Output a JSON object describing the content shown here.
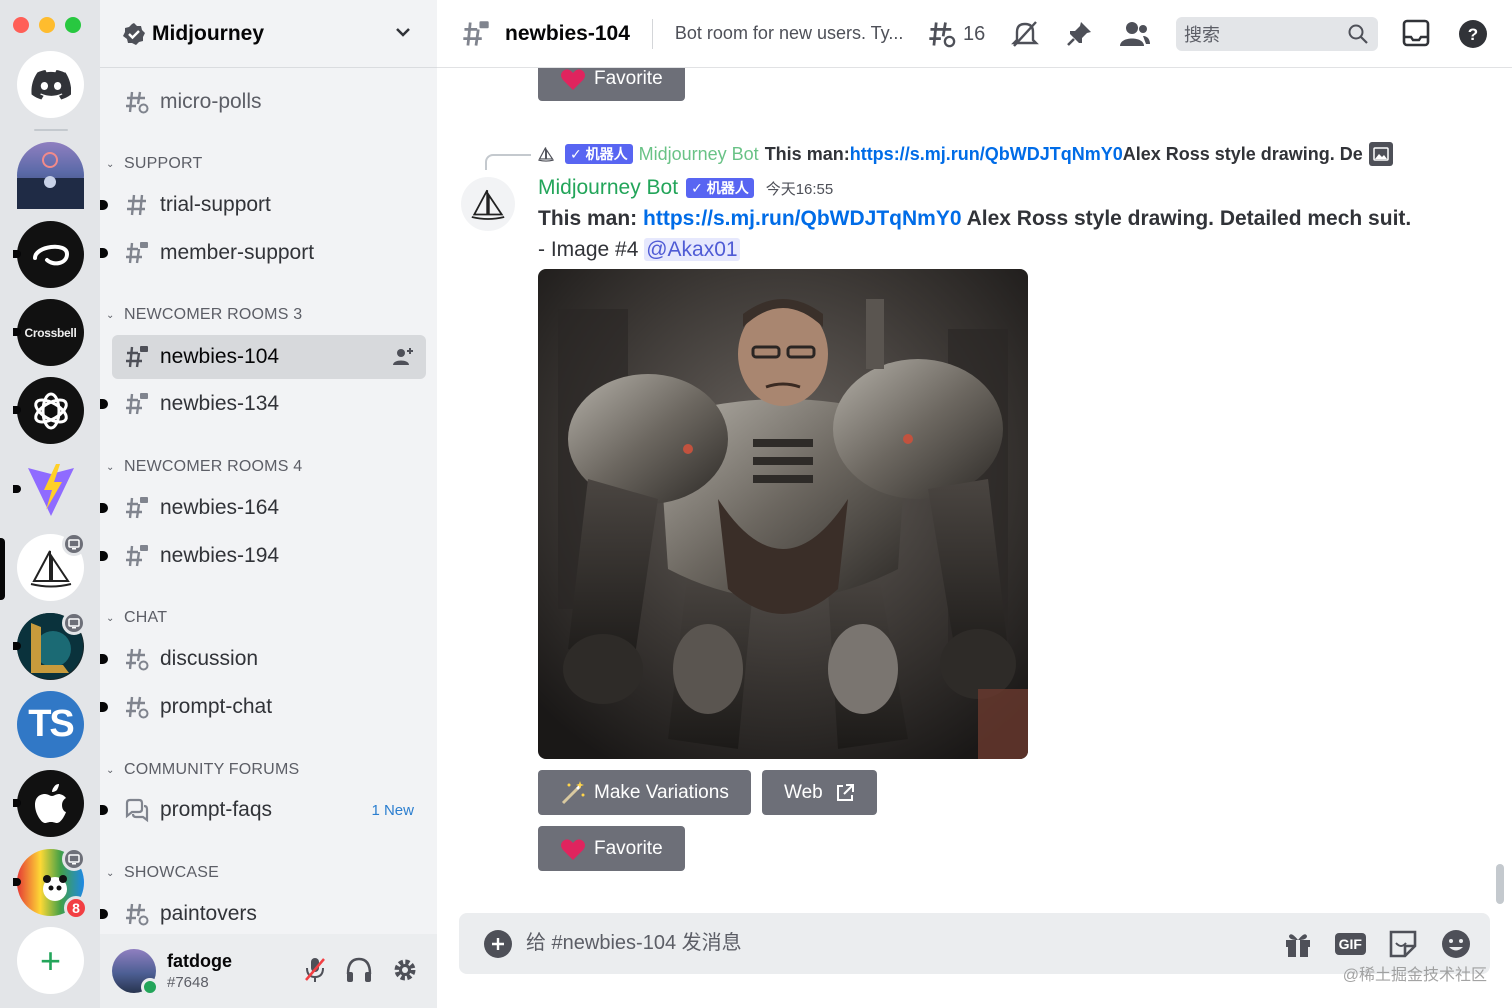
{
  "guild": {
    "name": "Midjourney"
  },
  "rail": {
    "server_3_label": "Crossbell",
    "server_8_label": "TS",
    "server_10_mentions": "8",
    "add_label": "+"
  },
  "channels": {
    "top": [
      {
        "name": "micro-polls"
      }
    ],
    "categories": [
      {
        "name": "SUPPORT",
        "items": [
          "trial-support",
          "member-support"
        ]
      },
      {
        "name": "NEWCOMER ROOMS 3",
        "items": [
          "newbies-104",
          "newbies-134"
        ]
      },
      {
        "name": "NEWCOMER ROOMS 4",
        "items": [
          "newbies-164",
          "newbies-194"
        ]
      },
      {
        "name": "CHAT",
        "items": [
          "discussion",
          "prompt-chat"
        ]
      },
      {
        "name": "COMMUNITY FORUMS",
        "items": [
          "prompt-faqs"
        ],
        "badge": "1 New"
      },
      {
        "name": "SHOWCASE",
        "items": [
          "paintovers"
        ]
      }
    ]
  },
  "user": {
    "name": "fatdoge",
    "tag": "#7648"
  },
  "header": {
    "channel": "newbies-104",
    "topic": "Bot room for new users. Ty...",
    "threads_count": "16",
    "search_placeholder": "搜索"
  },
  "messages": {
    "top_button": "Favorite",
    "reply": {
      "bot_tag": "机器人",
      "author": "Midjourney Bot",
      "text_prefix": "This man: ",
      "link": "https://s.mj.run/QbWDJTqNmY0",
      "text_suffix": " Alex Ross style drawing. De"
    },
    "main": {
      "author": "Midjourney Bot",
      "bot_tag": "机器人",
      "time": "今天16:55",
      "prefix": "This man: ",
      "link": "https://s.mj.run/QbWDJTqNmY0",
      "suffix": " Alex Ross style drawing. Detailed mech suit.",
      "line2": "- Image #4 ",
      "mention": "@Akax01"
    },
    "buttons": {
      "variations": "Make Variations",
      "web": "Web",
      "favorite": "Favorite"
    }
  },
  "composer": {
    "placeholder": "给 #newbies-104 发消息",
    "gif": "GIF"
  },
  "watermark": "@稀土掘金技术社区",
  "colors": {
    "accent": "#5865f2",
    "online": "#23a55a",
    "link": "#006ce7",
    "button": "#6d6f78"
  }
}
